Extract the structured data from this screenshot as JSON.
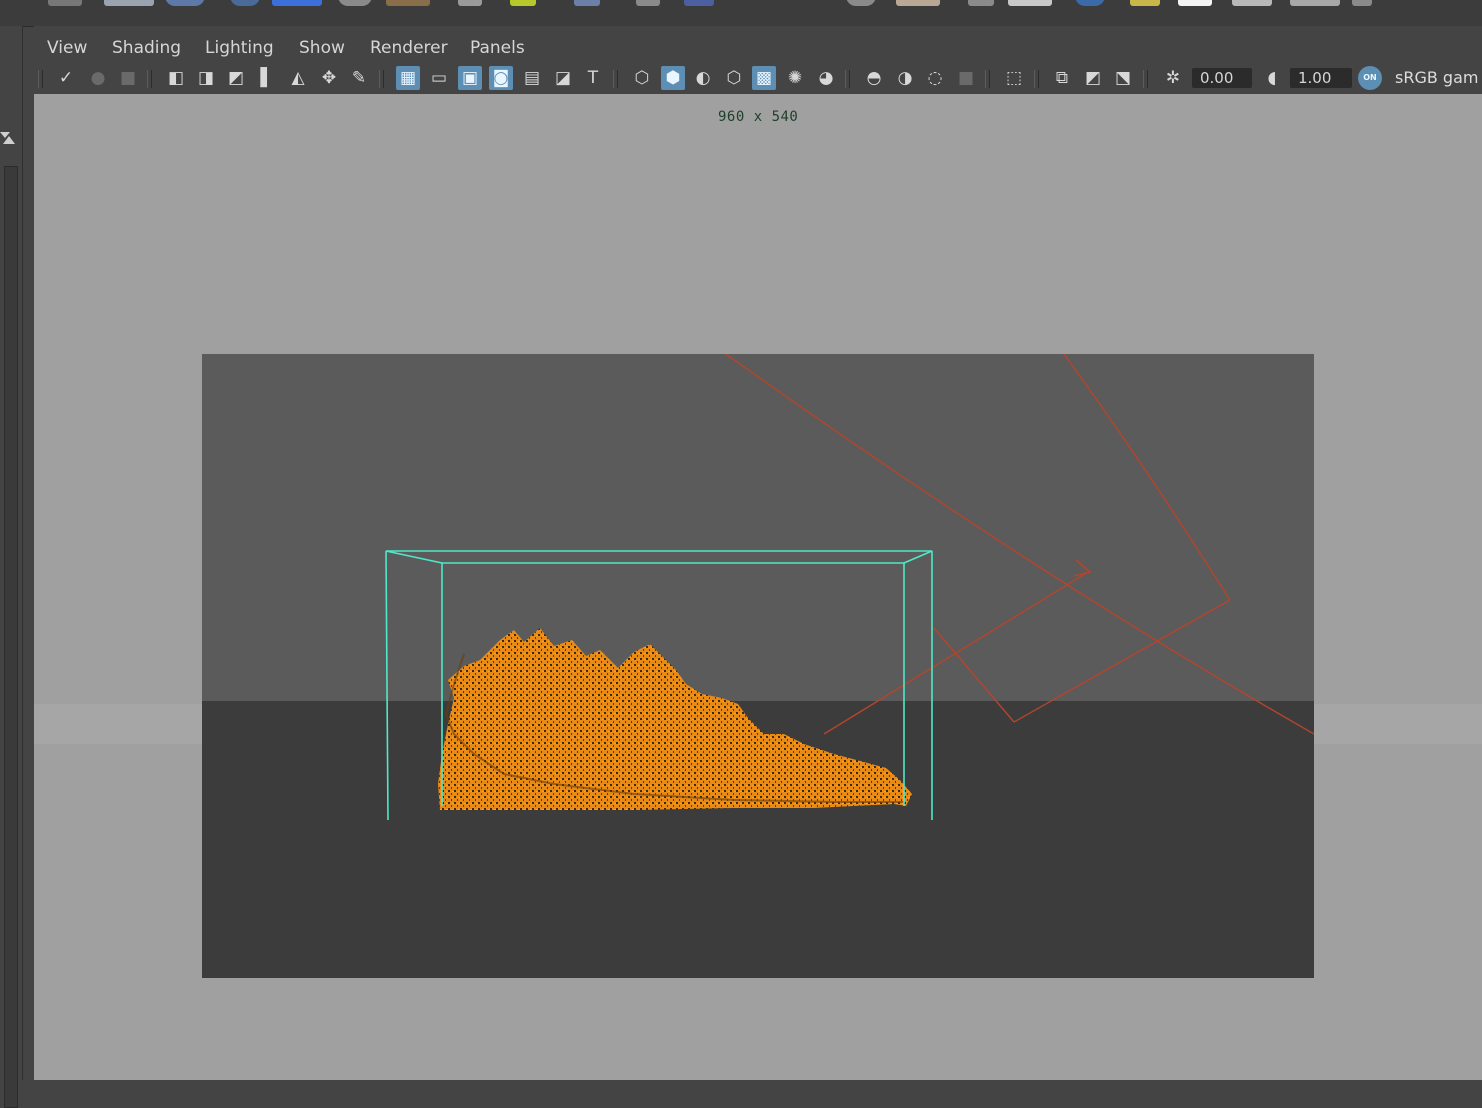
{
  "menu": {
    "view": "View",
    "shading": "Shading",
    "lighting": "Lighting",
    "show": "Show",
    "renderer": "Renderer",
    "panels": "Panels"
  },
  "toolbar": {
    "exposure_value": "0.00",
    "gamma_value": "1.00",
    "color_management_toggle": "ON",
    "color_space": "sRGB gam"
  },
  "viewport": {
    "resolution_gate_label": "960 x 540"
  },
  "colors": {
    "viewport_background": "#a0a0a0",
    "sky_gray": "#5b5b5b",
    "ground_gray": "#3c3c3c",
    "bounding_box": "#4fe8c8",
    "light_locator": "#b4452c",
    "fire": "#f08a10",
    "toolbar_active": "#5d8fb4"
  }
}
